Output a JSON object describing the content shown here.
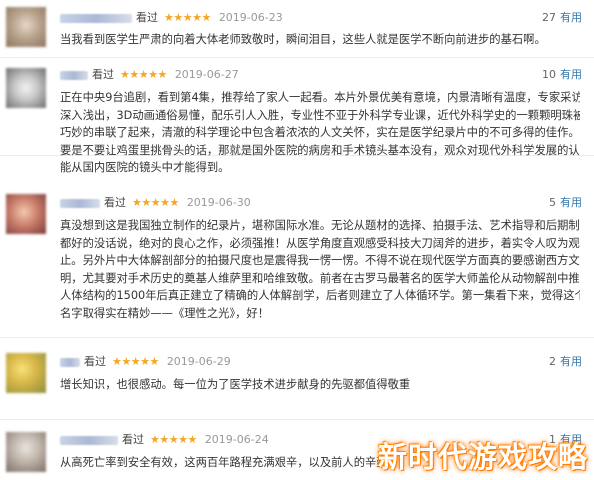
{
  "reviews": [
    {
      "status": "看过",
      "stars": "★★★★★",
      "date": "2019-06-23",
      "useful_count": "27",
      "useful_label": "有用",
      "lines": [
        "当我看到医学生严肃的向着大体老师致敬时，瞬间泪目，这些人就是医学不断向前进步的基石啊。"
      ]
    },
    {
      "status": "看过",
      "stars": "★★★★★",
      "date": "2019-06-27",
      "useful_count": "10",
      "useful_label": "有用",
      "lines": [
        "正在中央9台追剧，看到第4集，推荐给了家人一起看。本片外景优美有意境，内景清晰有温度，专家采访",
        "深入浅出，3D动画通俗易懂，配乐引人入胜，专业性不亚于外科学专业课，近代外科学史的一颗颗明珠被",
        "巧妙的串联了起来，清澈的科学理论中包含着浓浓的人文关怀，实在是医学纪录片中的不可多得的佳作。",
        "要是不要让鸡蛋里挑骨头的话，那就是国外医院的病房和手术镜头基本没有，观众对现代外科学发展的认知只",
        "能从国内医院的镜头中才能得到。"
      ]
    },
    {
      "status": "看过",
      "stars": "★★★★★",
      "date": "2019-06-30",
      "useful_count": "5",
      "useful_label": "有用",
      "lines": [
        "真没想到这是我国独立制作的纪录片，堪称国际水准。无论从题材的选择、拍摄手法、艺术指导和后期制作",
        "都好的没话说，绝对的良心之作，必须强推！从医学角度直观感受科技大刀阔斧的进步，着实令人叹为观",
        "止。另外片中大体解剖部分的拍摄尺度也是震得我一愣一愣。不得不说在现代医学方面真的要感谢西方文",
        "明，尤其要对手术历史的奠基人维萨里和哈维致敬。前者在古罗马最著名的医学大师盖伦从动物解剖中推理",
        "人体结构的1500年后真正建立了精确的人体解剖学，后者则建立了人体循环学。第一集看下来，觉得这个",
        "名字取得实在精妙——《理性之光》，好！"
      ]
    },
    {
      "status": "看过",
      "stars": "★★★★★",
      "date": "2019-06-29",
      "useful_count": "2",
      "useful_label": "有用",
      "lines": [
        "增长知识，也很感动。每一位为了医学技术进步献身的先驱都值得敬重"
      ]
    },
    {
      "status": "看过",
      "stars": "★★★★★",
      "date": "2019-06-24",
      "useful_count": "1",
      "useful_label": "有用",
      "lines": [
        "从高死亡率到安全有效，这两百年路程充满艰辛，以及前人的辛勤付出和付出"
      ]
    }
  ],
  "watermark": "新时代游戏攻略",
  "colors": {
    "star": "#f5a623",
    "useful_link": "#3377aa",
    "watermark_glow": "#ff7b00"
  }
}
